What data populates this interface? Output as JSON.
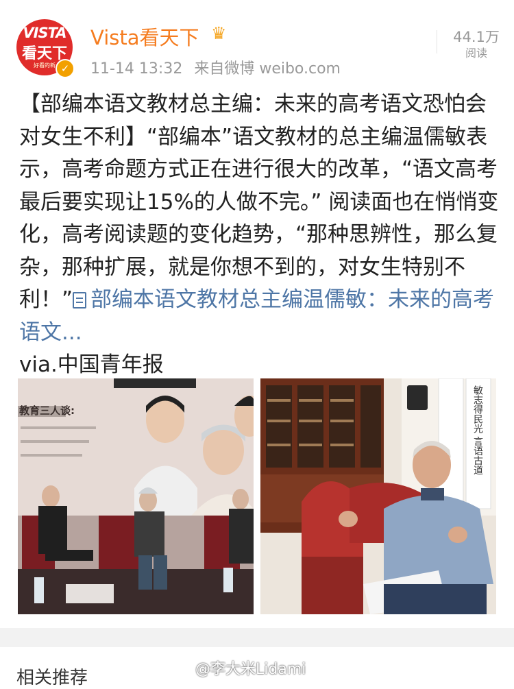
{
  "post": {
    "author": "Vista看天下",
    "avatar_text": [
      "VISTA",
      "看天下",
      "好看的新"
    ],
    "timestamp": "11-14 13:32",
    "source": "来自微博 weibo.com",
    "reads_count": "44.1万",
    "reads_label": "阅读",
    "text_main": "【部编本语文教材总主编：未来的高考语文恐怕会对女生不利】“部编本”语文教材的总主编温儒敏表示，高考命题方式正在进行很大的改革，“语文高考最后要实现让15%的人做不完。” 阅读面也在悄悄变化，高考阅读题的变化趋势，“那种思辨性，那么复杂，那种扩展，就是你想不到的，对女生特别不利！”",
    "link_text": "部编本语文教材总主编温儒敏：未来的高考语文...",
    "via": "via.中国青年报"
  },
  "images": [
    {
      "label": "教育三人谈:"
    },
    {
      "label": "敏志得民光 言语古道"
    }
  ],
  "related": {
    "title": "相关推荐"
  },
  "watermark": "@李大米Lidami",
  "colors": {
    "username": "#f57c1f",
    "link": "#4e76a6",
    "avatar_bg": "#e02c2a",
    "verified": "#f2a000"
  }
}
